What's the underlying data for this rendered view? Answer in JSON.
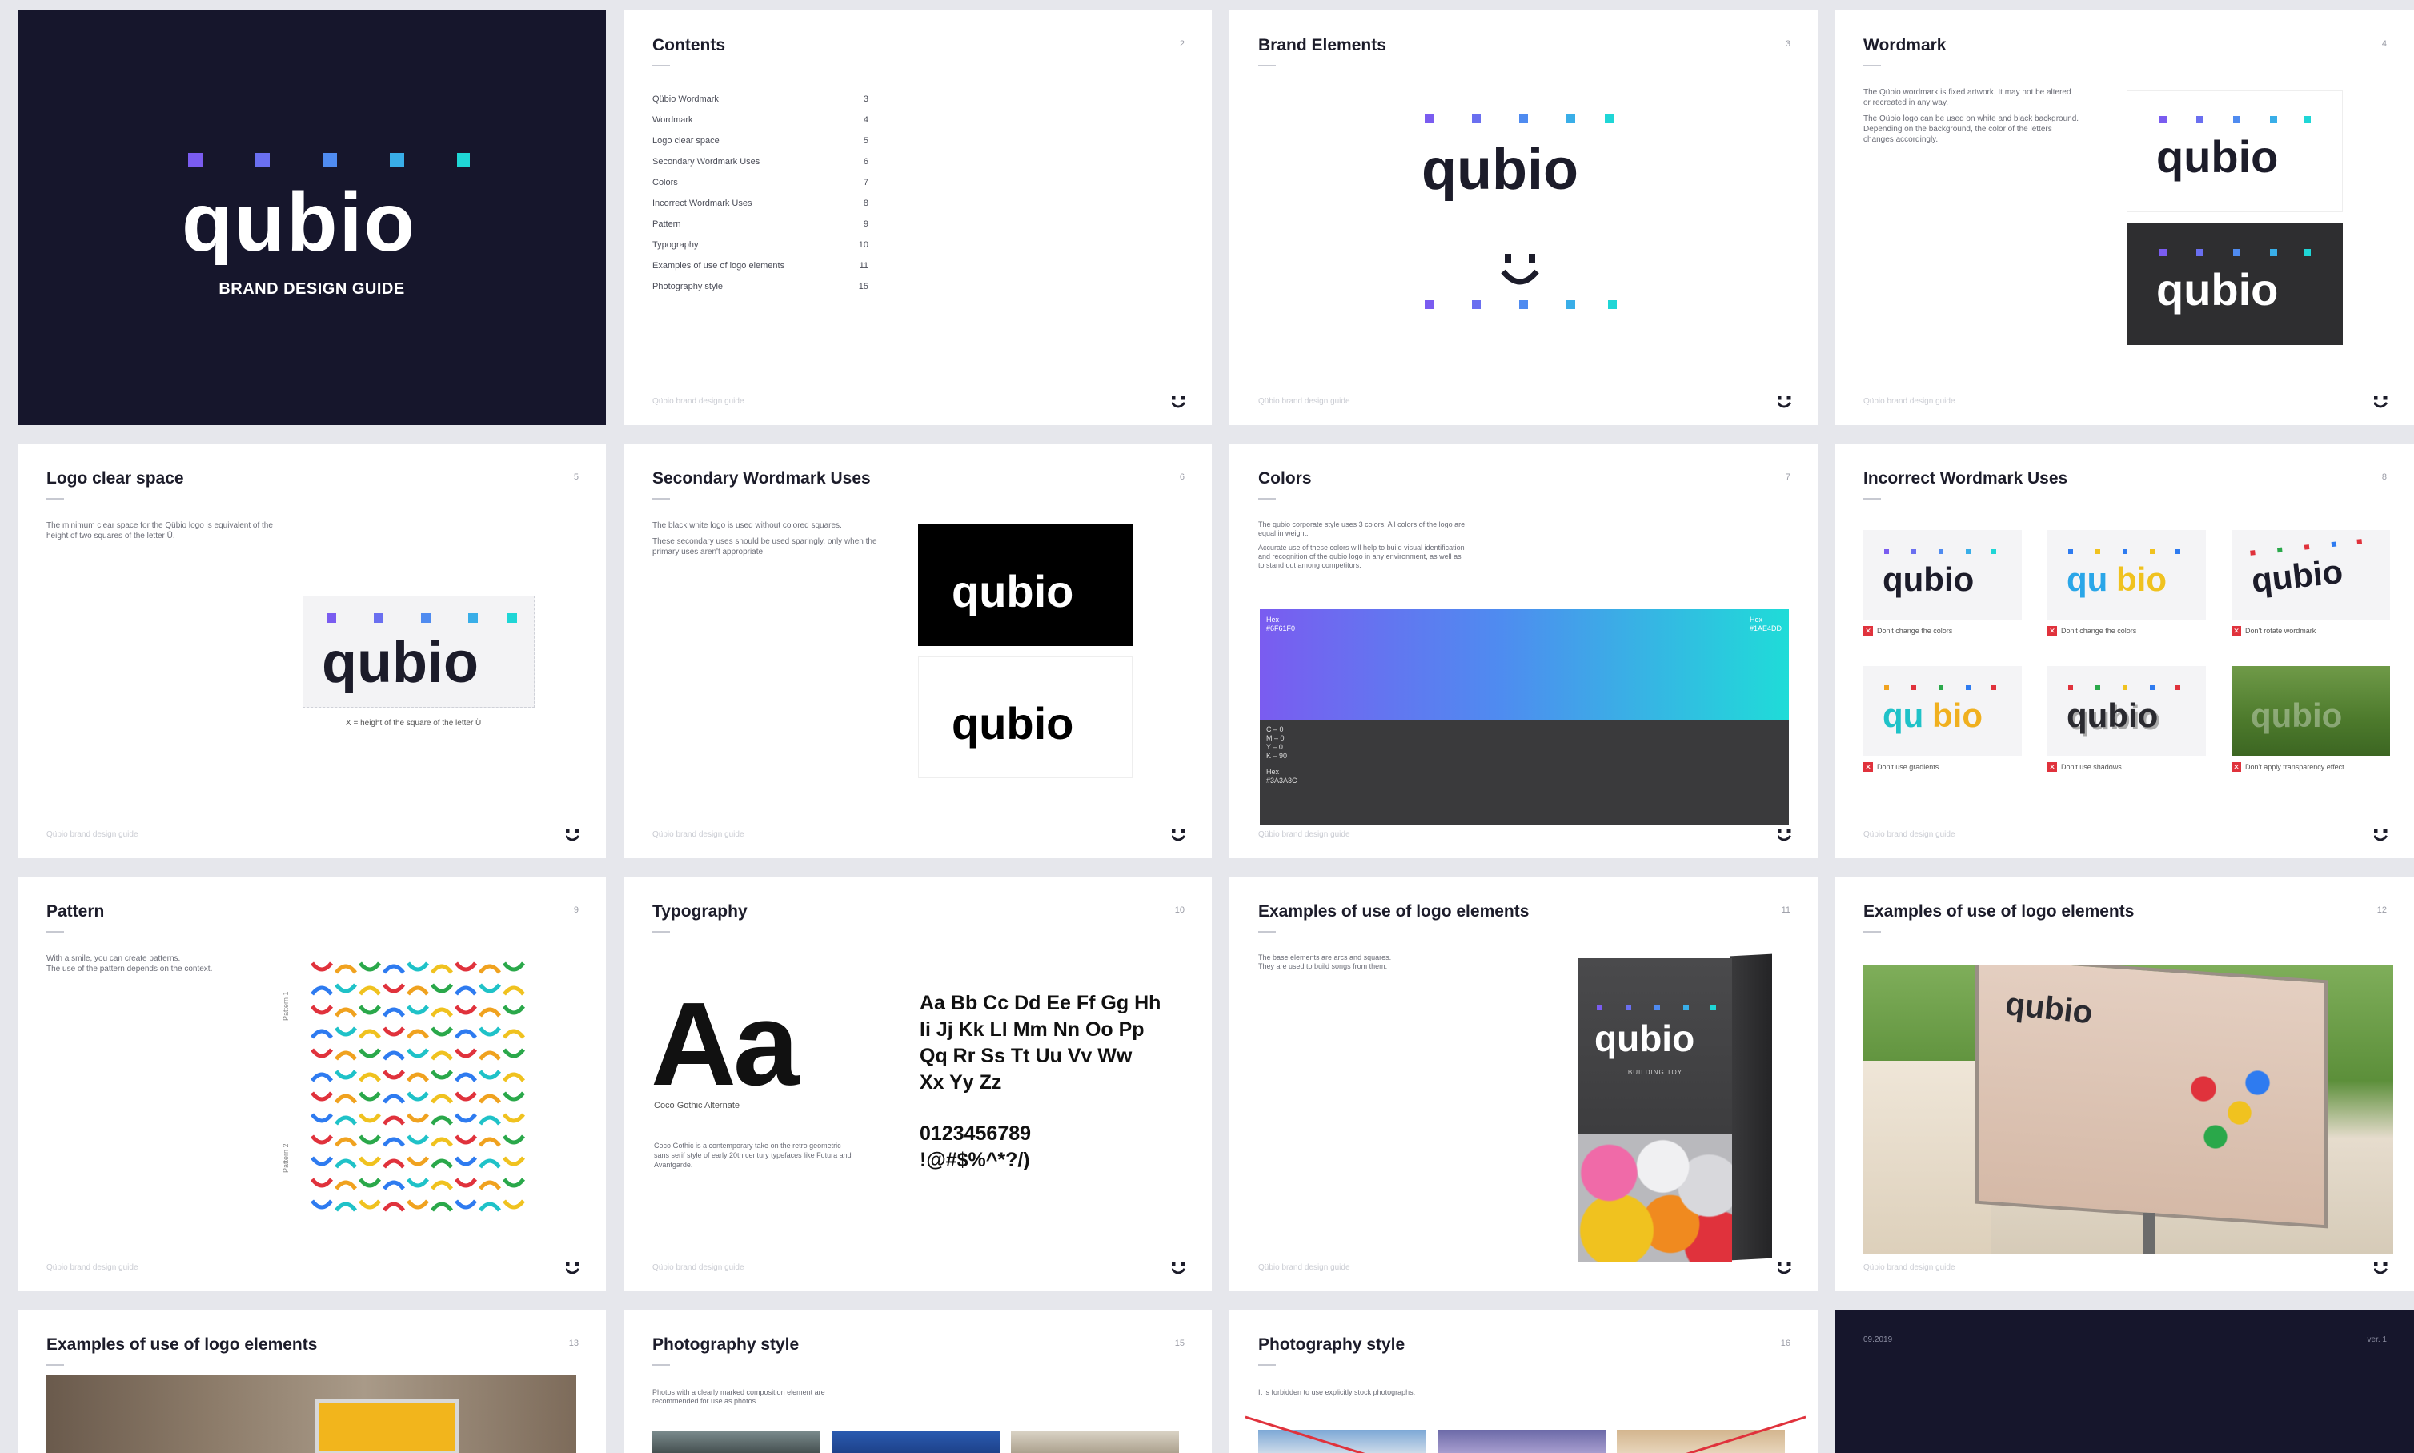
{
  "brand": {
    "name": "qubio",
    "cover_subtitle": "BRAND DESIGN GUIDE"
  },
  "footer_text": "Qübio brand design guide",
  "colors": {
    "purple": "#7A5CF0",
    "blue": "#4F8BF0",
    "cyan": "#1FD6D6",
    "dark": "#1C1C2A",
    "navy": "#16162C",
    "grey": "#3A3A3C"
  },
  "slides": {
    "contents": {
      "title": "Contents",
      "page": "2",
      "items": [
        {
          "label": "Qübio Wordmark",
          "page": "3"
        },
        {
          "label": "Wordmark",
          "page": "4"
        },
        {
          "label": "Logo clear space",
          "page": "5"
        },
        {
          "label": "Secondary Wordmark Uses",
          "page": "6"
        },
        {
          "label": "Colors",
          "page": "7"
        },
        {
          "label": "Incorrect Wordmark Uses",
          "page": "8"
        },
        {
          "label": "Pattern",
          "page": "9"
        },
        {
          "label": "Typography",
          "page": "10"
        },
        {
          "label": "Examples of use of logo elements",
          "page": "11"
        },
        {
          "label": "Photography style",
          "page": "15"
        }
      ]
    },
    "brand_elements": {
      "title": "Brand Elements",
      "page": "3"
    },
    "wordmark": {
      "title": "Wordmark",
      "page": "4",
      "text1": "The Qübio wordmark is fixed artwork. It may not be altered or recreated in any way.",
      "text2": "The Qübio logo can be used on white and black background. Depending on the background, the color of the letters changes accordingly."
    },
    "clear_space": {
      "title": "Logo clear space",
      "page": "5",
      "text": "The minimum clear space for the Qübio logo is equivalent of the height of two squares of the letter Ü.",
      "caption": "X = height of the square of the letter Ü"
    },
    "secondary": {
      "title": "Secondary Wordmark Uses",
      "page": "6",
      "text1": "The black white logo is used without colored squares.",
      "text2": "These secondary uses should be used sparingly, only when the primary uses aren't appropriate."
    },
    "colors": {
      "title": "Colors",
      "page": "7",
      "text1": "The qubio corporate style uses 3 colors. All colors of the logo are equal in weight.",
      "text2": "Accurate use of these colors will help to build visual identification and recognition of the qubio logo in any environment, as well as to stand out among competitors.",
      "hex_left": "Hex #6F61F0",
      "hex_right": "Hex #1AE4DD",
      "cmyk": "C – 0\nM – 0\nY – 0\nK – 90",
      "hex_dark": "Hex #3A3A3C"
    },
    "incorrect": {
      "title": "Incorrect Wordmark Uses",
      "page": "8",
      "items": [
        "Don't change the colors",
        "Don't change the colors",
        "Don't rotate wordmark",
        "Don't use gradients",
        "Don't use shadows",
        "Don't apply transparency effect"
      ]
    },
    "pattern": {
      "title": "Pattern",
      "page": "9",
      "text1": "With a smile, you can create patterns.",
      "text2": "The use of the pattern depends on the context.",
      "label1": "Pattern 1",
      "label2": "Pattern 2"
    },
    "typography": {
      "title": "Typography",
      "page": "10",
      "big": "Aa",
      "font_name": "Coco Gothic Alternate",
      "desc": "Coco Gothic is a contemporary take on the retro geometric sans serif style of early 20th century typefaces like Futura and Avantgarde.",
      "alphabet": [
        "Aa Bb Cc Dd Ee Ff Gg Hh",
        "Ii Jj Kk Ll Mm Nn Oo Pp",
        "Qq Rr Ss Tt Uu Vv Ww",
        "Xx Yy Zz"
      ],
      "digits": "0123456789",
      "symbols": "!@#$%^*?/)"
    },
    "examples1": {
      "title": "Examples of use of logo elements",
      "page": "11",
      "text1": "The base elements are arcs and squares.",
      "text2": "They are used to build songs from them.",
      "box_label": "BUILDING TOY"
    },
    "examples2": {
      "title": "Examples of use of logo elements",
      "page": "12"
    },
    "examples3": {
      "title": "Examples of use of logo elements",
      "page": "13"
    },
    "photo1": {
      "title": "Photography style",
      "page": "15",
      "text": "Photos with a clearly marked composition element are recommended for use as photos."
    },
    "photo2": {
      "title": "Photography style",
      "page": "16",
      "text": "It is forbidden to use explicitly stock photographs."
    },
    "last": {
      "date": "09.2019",
      "version": "ver. 1"
    }
  }
}
